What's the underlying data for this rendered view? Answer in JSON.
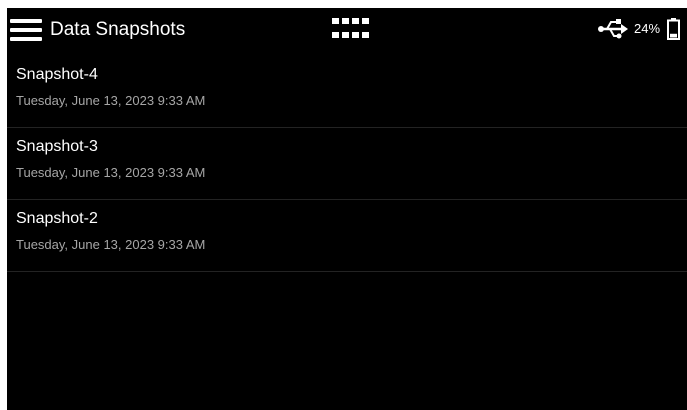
{
  "header": {
    "title": "Data Snapshots",
    "battery_percent": "24%",
    "icons": {
      "menu": "hamburger-menu-icon",
      "apps": "grid-icon",
      "connection": "usb-icon",
      "battery": "battery-icon"
    }
  },
  "snapshots": [
    {
      "name": "Snapshot-4",
      "date": "Tuesday, June 13, 2023 9:33 AM"
    },
    {
      "name": "Snapshot-3",
      "date": "Tuesday, June 13, 2023 9:33 AM"
    },
    {
      "name": "Snapshot-2",
      "date": "Tuesday, June 13, 2023 9:33 AM"
    }
  ],
  "colors": {
    "background": "#000000",
    "text_primary": "#ffffff",
    "text_secondary": "#a6a6a6",
    "divider": "#232323",
    "battery_fill": 0.24
  }
}
